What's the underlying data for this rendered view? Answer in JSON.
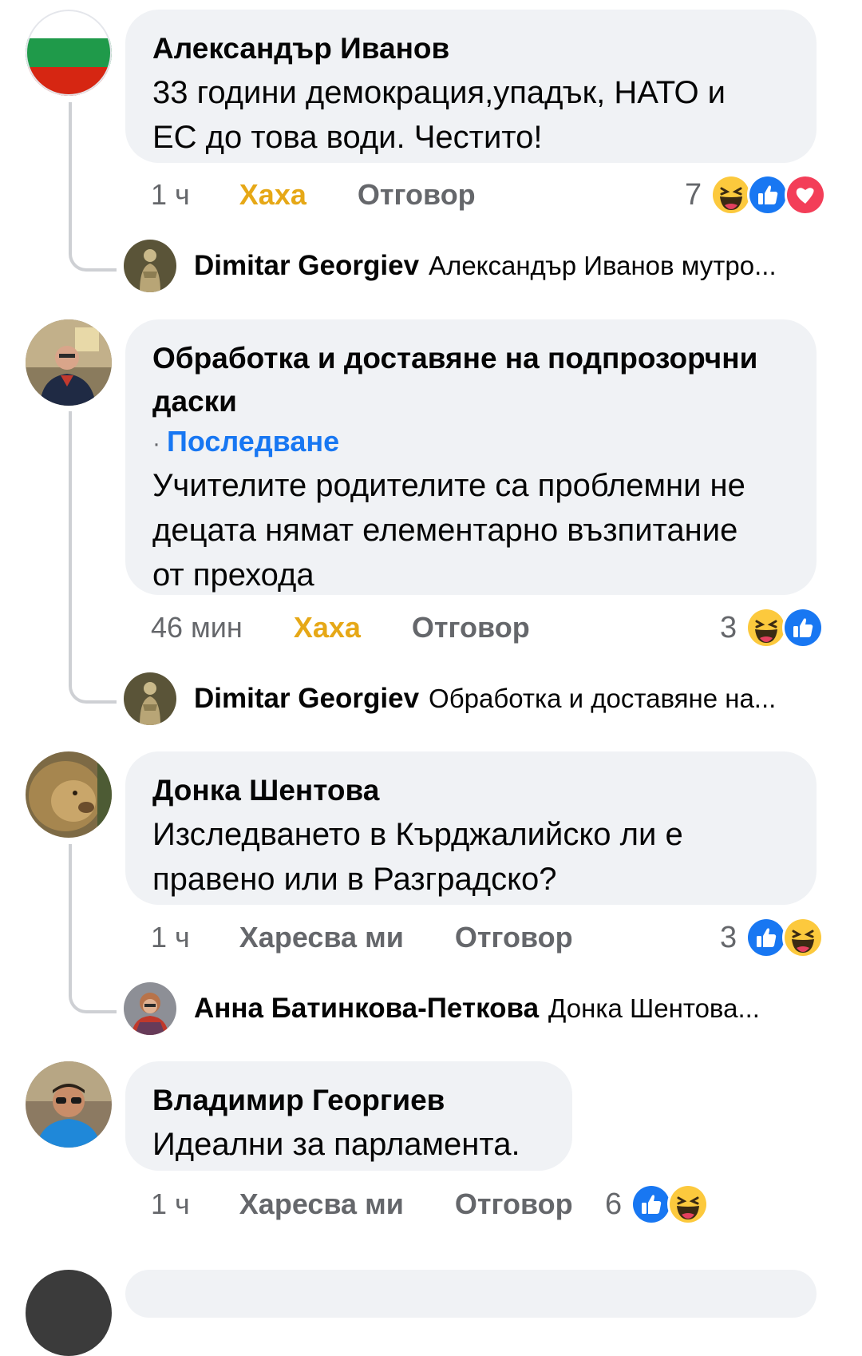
{
  "comments": [
    {
      "author": "Александър Иванов",
      "lines": [
        "33 години демокрация,упадък, НАТО и",
        "ЕС до това води. Честито!"
      ],
      "time": "1 ч",
      "reaction_label": "Хаха",
      "reaction_color": "#e6a817",
      "reply_label": "Отговор",
      "reaction_count": "7",
      "reaction_icons": [
        "haha-icon",
        "like-icon",
        "love-icon"
      ],
      "reply": {
        "author": "Dimitar Georgiev",
        "preview": "Александър Иванов мутро..."
      }
    },
    {
      "author_lines": [
        "Обработка и доставяне на подпрозорчни",
        "даски"
      ],
      "follow_dot": "·",
      "follow_label": "Последване",
      "lines": [
        "Учителите родителите са проблемни не",
        "децата нямат елементарно възпитание",
        "от прехода"
      ],
      "time": "46 мин",
      "reaction_label": "Хаха",
      "reply_label": "Отговор",
      "reaction_count": "3",
      "reaction_icons": [
        "haha-icon",
        "like-icon"
      ],
      "reply": {
        "author": "Dimitar Georgiev",
        "preview": "Обработка и доставяне на..."
      }
    },
    {
      "author": "Донка Шентова",
      "lines": [
        "Изследването в Кърджалийско ли е",
        "правено или в Разградско?"
      ],
      "time": "1 ч",
      "reaction_label": "Харесва ми",
      "reply_label": "Отговор",
      "reaction_count": "3",
      "reaction_icons": [
        "like-icon",
        "haha-icon"
      ],
      "reply": {
        "author": "Анна Батинкова-Петкова",
        "preview": "Донка Шентова..."
      }
    },
    {
      "author": "Владимир Георгиев",
      "lines": [
        "Идеални за парламента."
      ],
      "time": "1 ч",
      "reaction_label": "Харесва ми",
      "reply_label": "Отговор",
      "reaction_count": "6",
      "reaction_icons": [
        "like-icon",
        "haha-icon"
      ]
    }
  ],
  "colors": {
    "bubble": "#f0f2f5",
    "link_blue": "#1877f2",
    "meta_gray": "#65676b",
    "haha_yellow": "#e6a817"
  }
}
